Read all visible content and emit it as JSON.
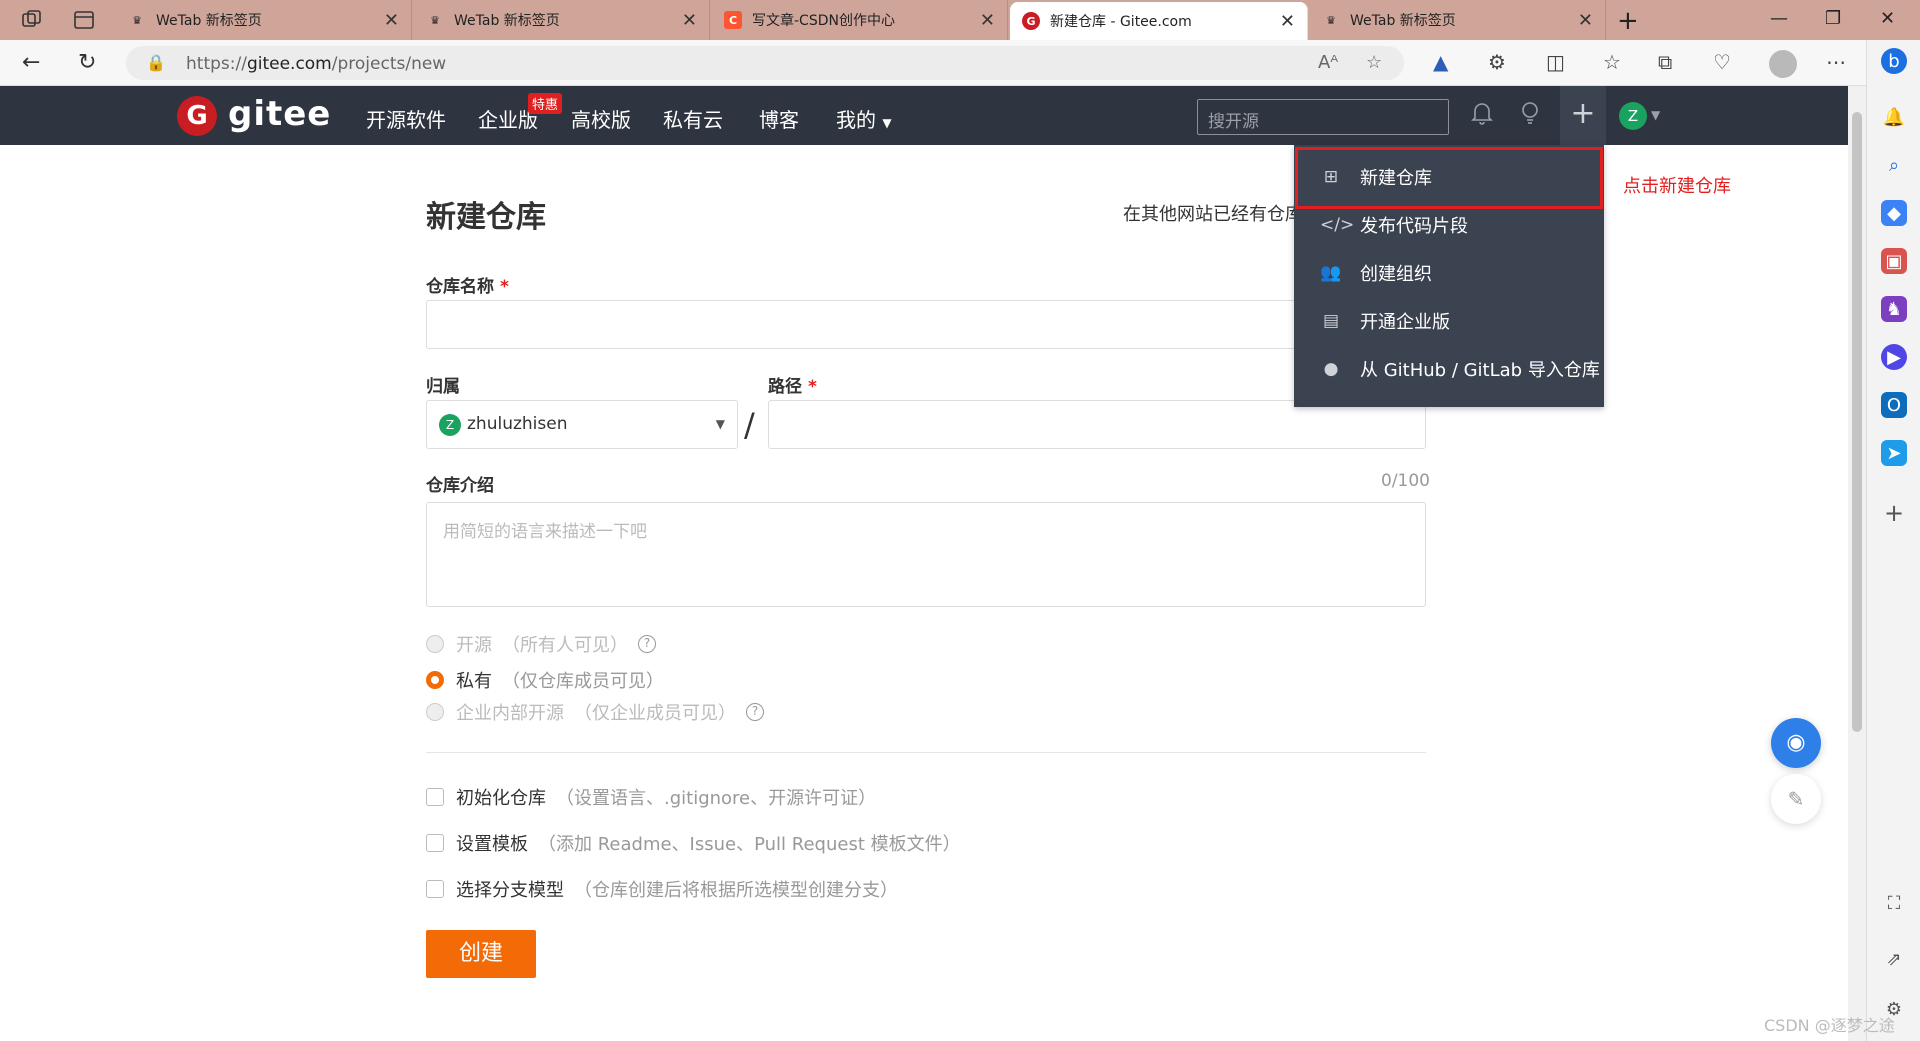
{
  "browser": {
    "tabs": [
      {
        "title": "WeTab 新标签页",
        "active": false
      },
      {
        "title": "WeTab 新标签页",
        "active": false
      },
      {
        "title": "写文章-CSDN创作中心",
        "active": false
      },
      {
        "title": "新建仓库 - Gitee.com",
        "active": true
      },
      {
        "title": "WeTab 新标签页",
        "active": false
      }
    ],
    "url_prefix": "https://",
    "url_host": "gitee.com",
    "url_path": "/projects/new"
  },
  "gitee": {
    "logo_text": "gitee",
    "nav": [
      "开源软件",
      "企业版",
      "高校版",
      "私有云",
      "博客",
      "我的"
    ],
    "badge": "特惠",
    "search_placeholder": "搜开源",
    "user_initial": "Z"
  },
  "form": {
    "page_title": "新建仓库",
    "import_text": "在其他网站已经有仓库",
    "repo_name_label": "仓库名称",
    "required_mark": "*",
    "owner_label": "归属",
    "path_label": "路径",
    "owner_name": "zhuluzhisen",
    "owner_initial": "Z",
    "slash": "/",
    "intro_label": "仓库介绍",
    "intro_counter": "0/100",
    "intro_placeholder": "用简短的语言来描述一下吧",
    "visibility": [
      {
        "label": "开源",
        "hint": "（所有人可见）",
        "selected": false,
        "disabled": true
      },
      {
        "label": "私有",
        "hint": "（仅仓库成员可见）",
        "selected": true,
        "disabled": false
      },
      {
        "label": "企业内部开源",
        "hint": "（仅企业成员可见）",
        "selected": false,
        "disabled": true
      }
    ],
    "options": [
      {
        "label": "初始化仓库",
        "hint": "（设置语言、.gitignore、开源许可证）"
      },
      {
        "label": "设置模板",
        "hint": "（添加 Readme、Issue、Pull Request 模板文件）"
      },
      {
        "label": "选择分支模型",
        "hint": "（仓库创建后将根据所选模型创建分支）"
      }
    ],
    "create_button": "创建"
  },
  "dropdown": {
    "items": [
      "新建仓库",
      "发布代码片段",
      "创建组织",
      "开通企业版",
      "从 GitHub / GitLab 导入仓库"
    ]
  },
  "annotation": "点击新建仓库",
  "watermark": "CSDN @逐梦之途",
  "colors": {
    "accent": "#f36b06",
    "header_bg": "#2e3440",
    "brand": "#c71d23",
    "highlight": "#e02020"
  }
}
